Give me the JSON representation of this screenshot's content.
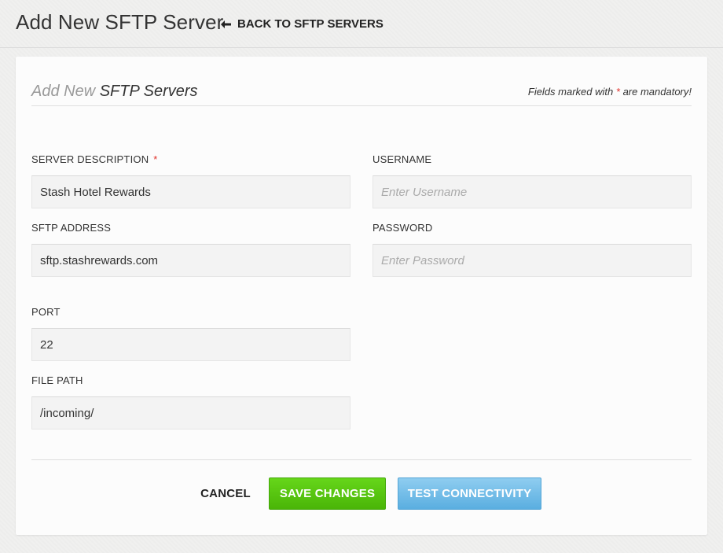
{
  "header": {
    "title": "Add New SFTP Server",
    "back_label": "BACK TO SFTP SERVERS"
  },
  "form": {
    "heading_light": "Add New",
    "heading_dark": "SFTP Servers",
    "mandatory_pre": "Fields marked with",
    "mandatory_star": "*",
    "mandatory_post": "are mandatory!",
    "fields": {
      "server_description": {
        "label": "SERVER DESCRIPTION",
        "required_mark": "*",
        "value": "Stash Hotel Rewards",
        "placeholder": ""
      },
      "username": {
        "label": "USERNAME",
        "value": "",
        "placeholder": "Enter Username"
      },
      "sftp_address": {
        "label": "SFTP ADDRESS",
        "value": "sftp.stashrewards.com",
        "placeholder": ""
      },
      "password": {
        "label": "PASSWORD",
        "value": "",
        "placeholder": "Enter Password"
      },
      "port": {
        "label": "PORT",
        "value": "22",
        "placeholder": ""
      },
      "file_path": {
        "label": "FILE PATH",
        "value": "/incoming/",
        "placeholder": ""
      }
    }
  },
  "actions": {
    "cancel": "CANCEL",
    "save": "SAVE CHANGES",
    "test": "TEST CONNECTIVITY"
  },
  "colors": {
    "required": "#e0302a",
    "save_button": "#5ac410",
    "test_button": "#70bde8"
  }
}
